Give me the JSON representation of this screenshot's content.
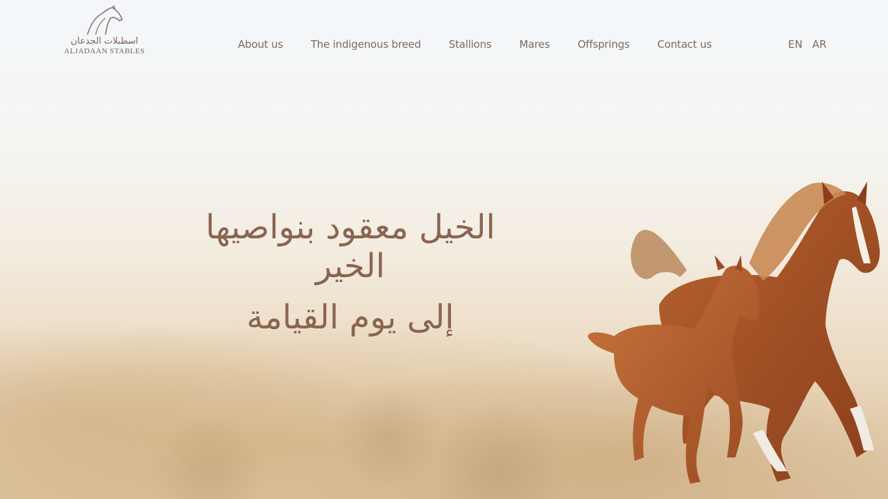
{
  "logo": {
    "arabic": "اسطبلات الجدعان",
    "english": "ALJADAAN STABLES"
  },
  "nav": {
    "items": [
      "About us",
      "The indigenous breed",
      "Stallions",
      "Mares",
      "Offsprings",
      "Contact us"
    ]
  },
  "lang": {
    "en": "EN",
    "ar": "AR"
  },
  "hero": {
    "line1": "الخيل معقود بنواصيها الخير",
    "line2": "إلى يوم القيامة"
  },
  "icons": {
    "logo_mark": "horse-head-icon",
    "hero_image": "horses-image"
  },
  "colors": {
    "text": "#7b6a60",
    "hero_text": "#8a6550",
    "horse": "#a4522a"
  }
}
